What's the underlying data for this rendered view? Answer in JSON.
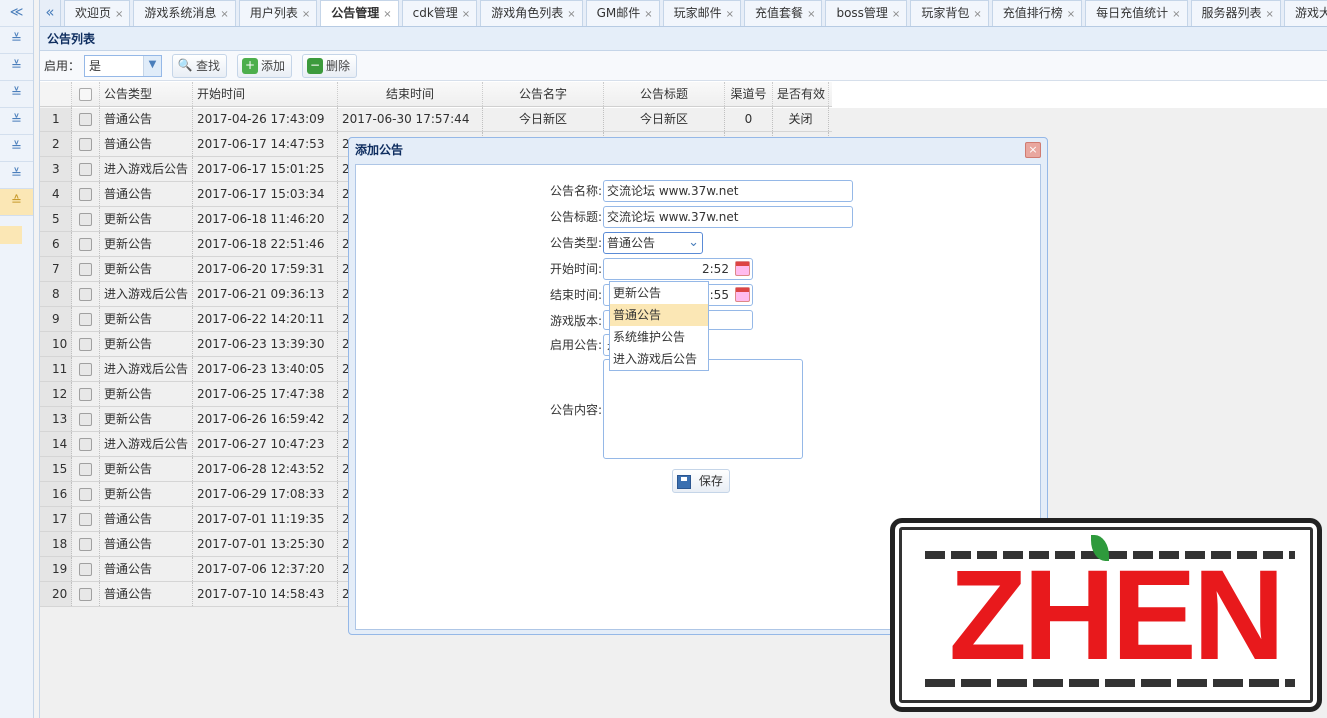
{
  "sidebar": {
    "items": [
      "≪",
      "≚",
      "≚",
      "≚",
      "≚",
      "≚",
      "≚",
      "≙"
    ]
  },
  "tabs": [
    {
      "label": "欢迎页",
      "active": false
    },
    {
      "label": "游戏系统消息",
      "active": false
    },
    {
      "label": "用户列表",
      "active": false
    },
    {
      "label": "公告管理",
      "active": true
    },
    {
      "label": "cdk管理",
      "active": false
    },
    {
      "label": "游戏角色列表",
      "active": false
    },
    {
      "label": "GM邮件",
      "active": false
    },
    {
      "label": "玩家邮件",
      "active": false
    },
    {
      "label": "充值套餐",
      "active": false
    },
    {
      "label": "boss管理",
      "active": false
    },
    {
      "label": "玩家背包",
      "active": false
    },
    {
      "label": "充值排行榜",
      "active": false
    },
    {
      "label": "每日充值统计",
      "active": false
    },
    {
      "label": "服务器列表",
      "active": false
    },
    {
      "label": "游戏大",
      "active": false
    }
  ],
  "tab_scroll_left": "«",
  "tab_close": "×",
  "panel": {
    "title": "公告列表"
  },
  "toolbar": {
    "enable_label": "启用：",
    "enable_value": "是",
    "search_label": "查找",
    "add_label": "添加",
    "delete_label": "删除"
  },
  "grid": {
    "columns": [
      "公告类型",
      "开始时间",
      "结束时间",
      "公告名字",
      "公告标题",
      "渠道号",
      "是否有效"
    ],
    "rows": [
      {
        "n": "1",
        "type": "普通公告",
        "start": "2017-04-26 17:43:09",
        "end": "2017-06-30 17:57:44",
        "name": "今日新区",
        "title": "今日新区",
        "ch": "0",
        "valid": "关闭"
      },
      {
        "n": "2",
        "type": "普通公告",
        "start": "2017-06-17 14:47:53",
        "end": "2"
      },
      {
        "n": "3",
        "type": "进入游戏后公告",
        "start": "2017-06-17 15:01:25",
        "end": "2"
      },
      {
        "n": "4",
        "type": "普通公告",
        "start": "2017-06-17 15:03:34",
        "end": "2"
      },
      {
        "n": "5",
        "type": "更新公告",
        "start": "2017-06-18 11:46:20",
        "end": "2"
      },
      {
        "n": "6",
        "type": "更新公告",
        "start": "2017-06-18 22:51:46",
        "end": "2"
      },
      {
        "n": "7",
        "type": "更新公告",
        "start": "2017-06-20 17:59:31",
        "end": "2"
      },
      {
        "n": "8",
        "type": "进入游戏后公告",
        "start": "2017-06-21 09:36:13",
        "end": "2"
      },
      {
        "n": "9",
        "type": "更新公告",
        "start": "2017-06-22 14:20:11",
        "end": "2"
      },
      {
        "n": "10",
        "type": "更新公告",
        "start": "2017-06-23 13:39:30",
        "end": "2"
      },
      {
        "n": "11",
        "type": "进入游戏后公告",
        "start": "2017-06-23 13:40:05",
        "end": "2"
      },
      {
        "n": "12",
        "type": "更新公告",
        "start": "2017-06-25 17:47:38",
        "end": "2"
      },
      {
        "n": "13",
        "type": "更新公告",
        "start": "2017-06-26 16:59:42",
        "end": "2"
      },
      {
        "n": "14",
        "type": "进入游戏后公告",
        "start": "2017-06-27 10:47:23",
        "end": "2"
      },
      {
        "n": "15",
        "type": "更新公告",
        "start": "2017-06-28 12:43:52",
        "end": "2"
      },
      {
        "n": "16",
        "type": "更新公告",
        "start": "2017-06-29 17:08:33",
        "end": "2"
      },
      {
        "n": "17",
        "type": "普通公告",
        "start": "2017-07-01 11:19:35",
        "end": "2"
      },
      {
        "n": "18",
        "type": "普通公告",
        "start": "2017-07-01 13:25:30",
        "end": "2"
      },
      {
        "n": "19",
        "type": "普通公告",
        "start": "2017-07-06 12:37:20",
        "end": "2"
      },
      {
        "n": "20",
        "type": "普通公告",
        "start": "2017-07-10 14:58:43",
        "end": "2"
      }
    ]
  },
  "dialog": {
    "title": "添加公告",
    "close": "×",
    "fields": {
      "name_label": "公告名称:",
      "name_value": "交流论坛 www.37w.net",
      "title_label": "公告标题:",
      "title_value": "交流论坛 www.37w.net",
      "type_label": "公告类型:",
      "type_value": "普通公告",
      "start_label": "开始时间:",
      "start_value_tail": "2:52",
      "end_label": "结束时间:",
      "end_value_tail": "2:55",
      "version_label": "游戏版本:",
      "enable_label": "启用公告:",
      "enable_value": "是",
      "content_label": "公告内容:"
    },
    "type_options": [
      "更新公告",
      "普通公告",
      "系统维护公告",
      "进入游戏后公告"
    ],
    "selected_option": "普通公告",
    "save_label": "保存"
  },
  "watermark": {
    "text": "ZHEN"
  },
  "colors": {
    "accent": "#95b8e7",
    "highlight": "#fbe7b5",
    "watermark_red": "#e8191c"
  }
}
